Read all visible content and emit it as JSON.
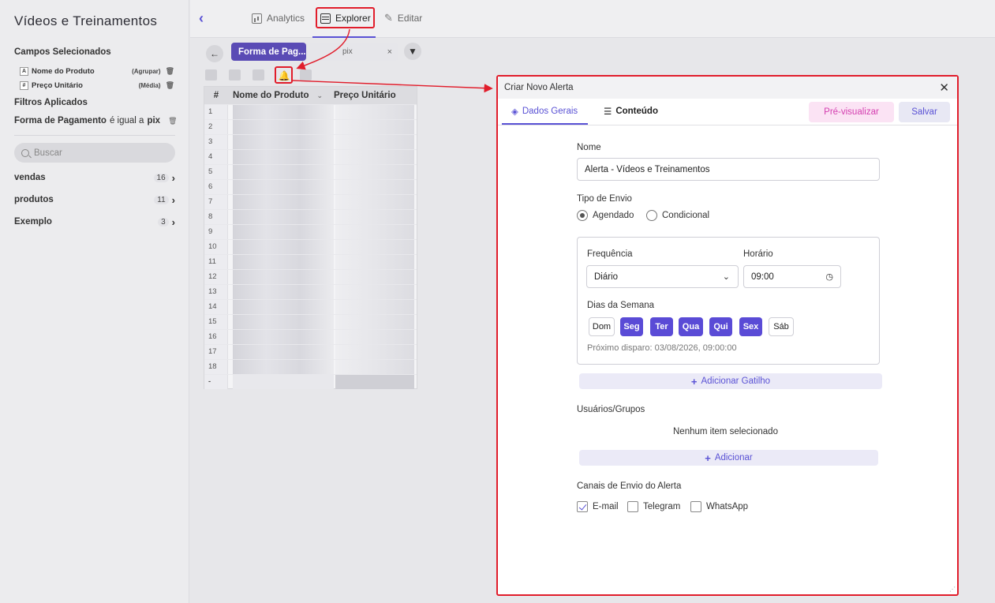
{
  "sidebar": {
    "title": "Vídeos e Treinamentos",
    "selected_fields_title": "Campos Selecionados",
    "fields": [
      {
        "type": "A",
        "name": "Nome do Produto",
        "agg": "(Agrupar)"
      },
      {
        "type": "#",
        "name": "Preço Unitário",
        "agg": "(Média)"
      }
    ],
    "filters_title": "Filtros Aplicados",
    "filter": {
      "field": "Forma de Pagamento",
      "op": "é igual a",
      "value": "pix"
    },
    "search_placeholder": "Buscar",
    "groups": [
      {
        "name": "vendas",
        "count": "16"
      },
      {
        "name": "produtos",
        "count": "11"
      },
      {
        "name": "Exemplo",
        "count": "3"
      }
    ]
  },
  "topnav": {
    "tabs": [
      {
        "label": "Analytics"
      },
      {
        "label": "Explorer"
      },
      {
        "label": "Editar"
      }
    ]
  },
  "explorer": {
    "filter_chip": "Forma de Pag...",
    "filter_value": "pix",
    "table": {
      "headers": [
        "#",
        "Nome do Produto",
        "Preço Unitário"
      ],
      "rows": [
        "1",
        "2",
        "3",
        "4",
        "5",
        "6",
        "7",
        "8",
        "9",
        "10",
        "11",
        "12",
        "13",
        "14",
        "15",
        "16",
        "17",
        "18"
      ],
      "total": "-"
    }
  },
  "modal": {
    "title": "Criar Novo Alerta",
    "tabs": [
      "Dados Gerais",
      "Conteúdo"
    ],
    "preview_label": "Pré-visualizar",
    "save_label": "Salvar",
    "name_label": "Nome",
    "name_value": "Alerta - Vídeos e Treinamentos",
    "send_type_label": "Tipo de Envio",
    "send_types": [
      "Agendado",
      "Condicional"
    ],
    "frequency_label": "Frequência",
    "frequency_value": "Diário",
    "time_label": "Horário",
    "time_value": "09:00",
    "weekdays_label": "Dias da Semana",
    "weekdays": [
      {
        "label": "Dom",
        "on": false
      },
      {
        "label": "Seg",
        "on": true
      },
      {
        "label": "Ter",
        "on": true
      },
      {
        "label": "Qua",
        "on": true
      },
      {
        "label": "Qui",
        "on": true
      },
      {
        "label": "Sex",
        "on": true
      },
      {
        "label": "Sáb",
        "on": false
      }
    ],
    "next_fire": "Próximo disparo: 03/08/2026, 09:00:00",
    "add_trigger": "Adicionar Gatilho",
    "users_label": "Usuários/Grupos",
    "users_empty": "Nenhum item selecionado",
    "add_user": "Adicionar",
    "channels_label": "Canais de Envio do Alerta",
    "channels": [
      {
        "label": "E-mail",
        "on": true
      },
      {
        "label": "Telegram",
        "on": false
      },
      {
        "label": "WhatsApp",
        "on": false
      }
    ]
  },
  "colors": {
    "accent": "#5a52d5",
    "highlight": "#e11d2b",
    "preview": "#d43fb0"
  }
}
